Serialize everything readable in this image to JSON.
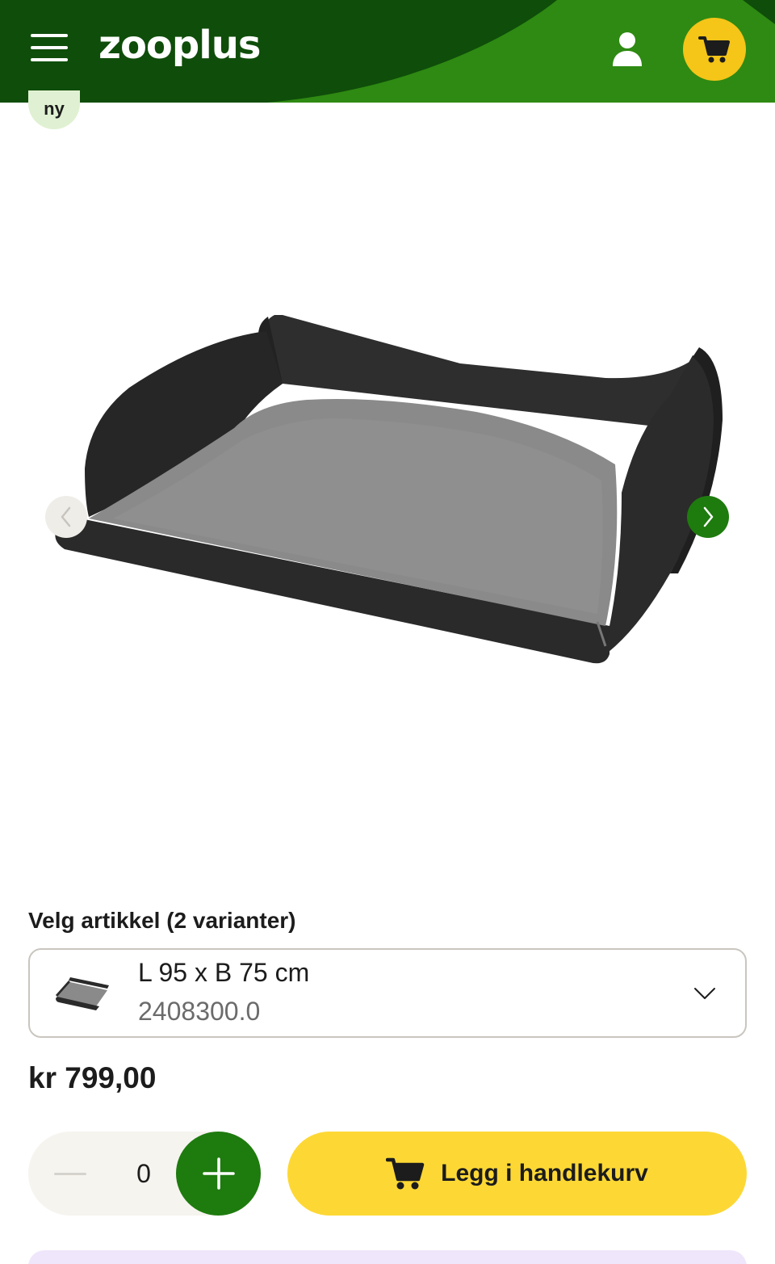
{
  "header": {
    "logo_text": "zooplus",
    "menu_icon": "hamburger-menu-icon",
    "account_icon": "user-icon",
    "cart_icon": "shopping-cart-icon",
    "colors": {
      "dark_green": "#0f4d0a",
      "light_green": "#2e8a12",
      "cart_yellow": "#f5c518"
    }
  },
  "badge": {
    "label": "ny"
  },
  "carousel": {
    "prev_icon": "chevron-left-icon",
    "next_icon": "chevron-right-icon",
    "image_alt": "dog bed product image"
  },
  "variant": {
    "label": "Velg artikkel (2 varianter)",
    "selected_size": "L 95 x B 75 cm",
    "selected_code": "2408300.0",
    "chevron_icon": "chevron-down-icon"
  },
  "price": {
    "text": "kr 799,00"
  },
  "quantity": {
    "value": "0",
    "minus_icon": "minus-icon",
    "plus_icon": "plus-icon"
  },
  "cta": {
    "label": "Legg i handlekurv",
    "icon": "shopping-cart-icon",
    "color": "#fdd835"
  }
}
